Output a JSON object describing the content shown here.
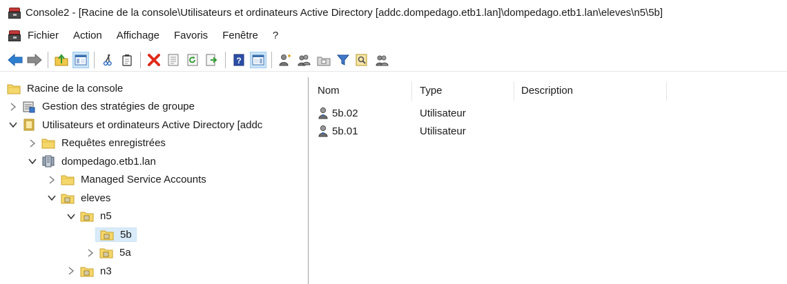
{
  "window": {
    "title": "Console2 - [Racine de la console\\Utilisateurs et ordinateurs Active Directory [addc.dompedago.etb1.lan]\\dompedago.etb1.lan\\eleves\\n5\\5b]",
    "app_icon": "mmc-toolbox-icon"
  },
  "menu": {
    "items": [
      "Fichier",
      "Action",
      "Affichage",
      "Favoris",
      "Fenêtre",
      "?"
    ]
  },
  "toolbar": {
    "buttons": [
      "back-arrow-icon",
      "forward-arrow-icon",
      "up-level-icon",
      "show-hide-tree-icon",
      "cut-icon",
      "copy-icon",
      "delete-icon",
      "properties-icon",
      "refresh-icon",
      "export-list-icon",
      "help-icon",
      "show-action-pane-icon",
      "new-user-icon",
      "new-group-icon",
      "new-ou-icon",
      "filter-icon",
      "find-icon",
      "add-to-group-icon"
    ]
  },
  "tree": {
    "nodes": [
      {
        "label": "Racine de la console",
        "level": 0,
        "expander": "none",
        "icon": "folder-icon"
      },
      {
        "label": "Gestion des stratégies de groupe",
        "level": 0,
        "expander": "collapsed",
        "icon": "gpo-icon"
      },
      {
        "label": "Utilisateurs et ordinateurs Active Directory [addc",
        "level": 0,
        "expander": "expanded",
        "icon": "aduc-icon"
      },
      {
        "label": "Requêtes enregistrées",
        "level": 1,
        "expander": "collapsed",
        "icon": "folder-icon"
      },
      {
        "label": "dompedago.etb1.lan",
        "level": 1,
        "expander": "expanded",
        "icon": "domain-icon"
      },
      {
        "label": "Managed Service Accounts",
        "level": 2,
        "expander": "collapsed",
        "icon": "folder-icon"
      },
      {
        "label": "eleves",
        "level": 2,
        "expander": "expanded",
        "icon": "ou-icon"
      },
      {
        "label": "n5",
        "level": 3,
        "expander": "expanded",
        "icon": "ou-icon"
      },
      {
        "label": "5b",
        "level": 4,
        "expander": "none",
        "icon": "ou-icon",
        "selected": true
      },
      {
        "label": "5a",
        "level": 4,
        "expander": "collapsed",
        "icon": "ou-icon"
      },
      {
        "label": "n3",
        "level": 3,
        "expander": "collapsed",
        "icon": "ou-icon"
      }
    ]
  },
  "list": {
    "columns": [
      "Nom",
      "Type",
      "Description"
    ],
    "rows": [
      {
        "name": "5b.02",
        "type": "Utilisateur",
        "description": "",
        "icon": "user-icon"
      },
      {
        "name": "5b.01",
        "type": "Utilisateur",
        "description": "",
        "icon": "user-icon"
      }
    ]
  },
  "colors": {
    "selection": "#d9ebf9",
    "selection_border": "#cce4f7",
    "back_arrow": "#2f7fd1",
    "delete": "#e02a1a",
    "folder": "#f5d76b"
  }
}
